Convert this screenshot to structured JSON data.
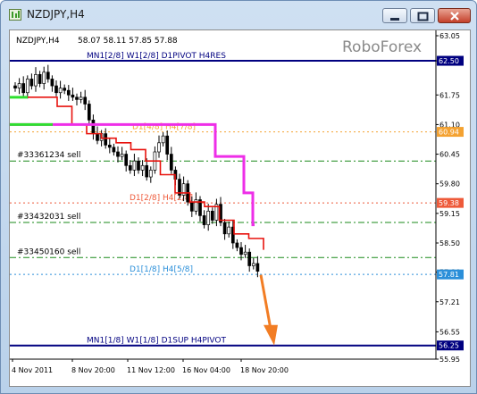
{
  "window": {
    "title": "NZDJPY,H4"
  },
  "chart_header": {
    "symbol_tf": "NZDJPY,H4",
    "ohlc": "58.07 58.11 57.85 57.88",
    "watermark": "RoboForex"
  },
  "chart_data": {
    "type": "line",
    "title": "",
    "ylim": [
      55.95,
      63.05
    ],
    "y_ticks": [
      "63.05",
      "62.50",
      "61.75",
      "61.10",
      "60.45",
      "59.80",
      "59.15",
      "58.50",
      "57.86",
      "57.21",
      "56.55",
      "55.95"
    ],
    "x_ticks": [
      "4 Nov 2011",
      "8 Nov 20:00",
      "11 Nov 12:00",
      "16 Nov 04:00",
      "18 Nov 20:00"
    ],
    "levels": [
      {
        "price": 62.5,
        "label": "MN1[2/8] W1[2/8] D1PIVOT H4RES",
        "tag": "62.50",
        "color": "#000080",
        "style": "solid"
      },
      {
        "price": 60.94,
        "label": "D1[4/8] H4[7/8]",
        "tag": "60.94",
        "color": "#f4a231",
        "style": "dotted"
      },
      {
        "price": 59.38,
        "label": "D1[2/8] H4[2/8]",
        "tag": "59.38",
        "color": "#ee5a3a",
        "style": "dotted"
      },
      {
        "price": 57.81,
        "label": "D1[1/8] H4[5/8]",
        "tag": "57.81",
        "color": "#2b8fd9",
        "style": "dotted"
      },
      {
        "price": 56.25,
        "label": "MN1[1/8] W1[1/8] D1SUP H4PIVOT",
        "tag": "56.25",
        "color": "#000080",
        "style": "solid"
      }
    ],
    "orders": [
      {
        "label": "#33361234 sell",
        "price": 60.3
      },
      {
        "label": "#33432031 sell",
        "price": 58.95
      },
      {
        "label": "#33450160 sell",
        "price": 58.18
      }
    ],
    "series": [
      {
        "name": "",
        "color": "#e8130e",
        "values": [
          61.7,
          61.7,
          61.5,
          61.1,
          60.9,
          60.8,
          60.7,
          60.55,
          60.3,
          60.0,
          59.6,
          59.4,
          59.3,
          59.0,
          58.7,
          58.6,
          58.35
        ]
      },
      {
        "name": "",
        "color": "#ee2ee8",
        "values": [
          61.1,
          61.1,
          61.1,
          61.1,
          61.1,
          61.1,
          61.1,
          60.4,
          60.4,
          60.4,
          60.4,
          59.6,
          59.6,
          59.6,
          58.9
        ]
      }
    ],
    "closes": [
      61.9,
      62.0,
      61.8,
      62.1,
      61.95,
      62.2,
      62.0,
      62.25,
      62.1,
      61.95,
      61.8,
      61.9,
      61.85,
      61.75,
      61.7,
      61.65,
      61.7,
      61.55,
      61.2,
      60.9,
      60.75,
      60.9,
      60.65,
      60.6,
      60.5,
      60.4,
      60.45,
      60.2,
      60.1,
      60.3,
      60.1,
      60.2,
      59.95,
      60.1,
      60.5,
      60.7,
      60.85,
      60.45,
      60.1,
      59.9,
      59.55,
      59.8,
      59.4,
      59.2,
      59.45,
      59.1,
      58.9,
      59.2,
      59.0,
      59.35,
      58.95,
      58.7,
      58.85,
      58.5,
      58.4,
      58.25,
      58.3,
      58.0,
      58.05,
      57.88
    ]
  }
}
